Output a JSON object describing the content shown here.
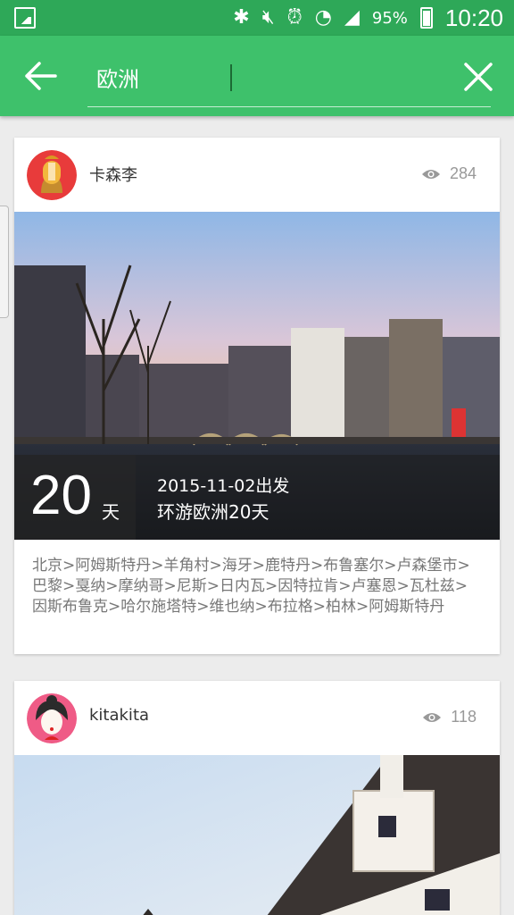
{
  "status_bar": {
    "battery_pct": "95%",
    "time": "10:20"
  },
  "search": {
    "query": "欧洲"
  },
  "posts": [
    {
      "author": "卡森李",
      "views": "284",
      "days": "20",
      "days_unit": "天",
      "date": "2015-11-02出发",
      "title": "环游欧洲20天",
      "route": "北京>阿姆斯特丹>羊角村>海牙>鹿特丹>布鲁塞尔>卢森堡市>巴黎>戛纳>摩纳哥>尼斯>日内瓦>因特拉肯>卢塞恩>瓦杜兹>因斯布鲁克>哈尔施塔特>维也纳>布拉格>柏林>阿姆斯特丹"
    },
    {
      "author": "kitakita",
      "views": "118"
    }
  ],
  "colors": {
    "status_bar": "#2ea858",
    "app_bar": "#3ec16b"
  }
}
